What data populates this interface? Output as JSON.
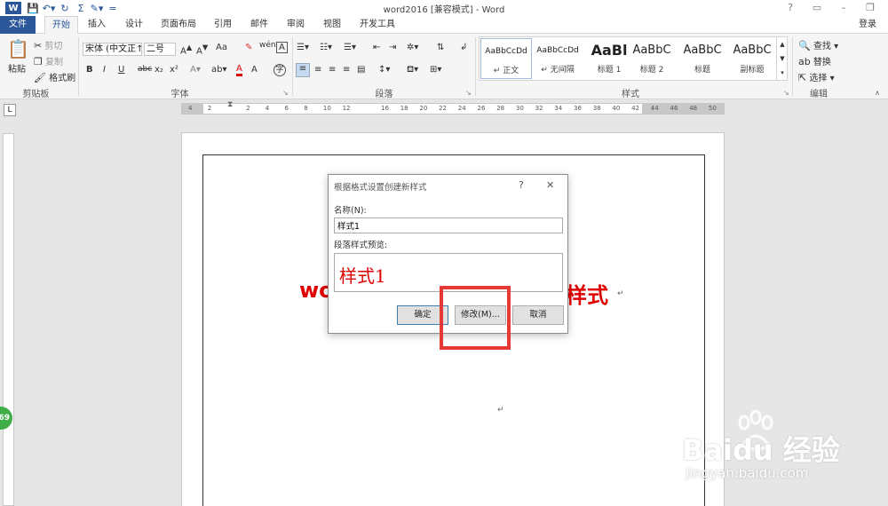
{
  "window": {
    "title": "word2016 [兼容模式] - Word",
    "login": "登录"
  },
  "tabs": [
    "文件",
    "开始",
    "插入",
    "设计",
    "页面布局",
    "引用",
    "邮件",
    "审阅",
    "视图",
    "开发工具"
  ],
  "clipboard": {
    "paste": "粘贴",
    "cut": "剪切",
    "copy": "复制",
    "format_painter": "格式刷",
    "group": "剪贴板"
  },
  "font": {
    "family": "宋体 (中文正↑",
    "size": "二号",
    "bold": "B",
    "italic": "I",
    "underline": "U",
    "strike": "abc",
    "sub": "x₂",
    "sup": "x²",
    "aa": "Aa",
    "group": "字体"
  },
  "paragraph": {
    "group": "段落"
  },
  "styles": {
    "group": "样式",
    "items": [
      {
        "sample": "AaBbCcDd",
        "name": "↵ 正文"
      },
      {
        "sample": "AaBbCcDd",
        "name": "↵ 无间隔"
      },
      {
        "sample": "AaBl",
        "name": "标题 1"
      },
      {
        "sample": "AaBbC",
        "name": "标题 2"
      },
      {
        "sample": "AaBbC",
        "name": "标题"
      },
      {
        "sample": "AaBbC",
        "name": "副标题"
      }
    ]
  },
  "editing": {
    "find": "查找",
    "replace": "替换",
    "select": "选择",
    "group": "编辑"
  },
  "ruler": {
    "numbers": [
      "4",
      "2",
      "",
      "2",
      "4",
      "6",
      "8",
      "10",
      "12",
      "",
      "16",
      "18",
      "20",
      "22",
      "24",
      "26",
      "28",
      "30",
      "32",
      "34",
      "36",
      "38",
      "40",
      "42",
      "44",
      "46",
      "48",
      "50"
    ]
  },
  "document": {
    "text_left": "wo",
    "text_right": "样式",
    "para_mark": "↵"
  },
  "dialog": {
    "title": "根据格式设置创建新样式",
    "help": "?",
    "close": "✕",
    "name_label": "名称(N):",
    "name_value": "样式1",
    "preview_label": "段落样式预览:",
    "preview_text": "样式1",
    "ok": "确定",
    "modify": "修改(M)...",
    "cancel": "取消"
  },
  "badge": "69",
  "watermark": {
    "brand": "Baidu 经验",
    "url": "jingyan.baidu.com"
  },
  "colors": {
    "accent": "#2b579a",
    "red_text": "#e00000",
    "highlight": "#e53935"
  }
}
